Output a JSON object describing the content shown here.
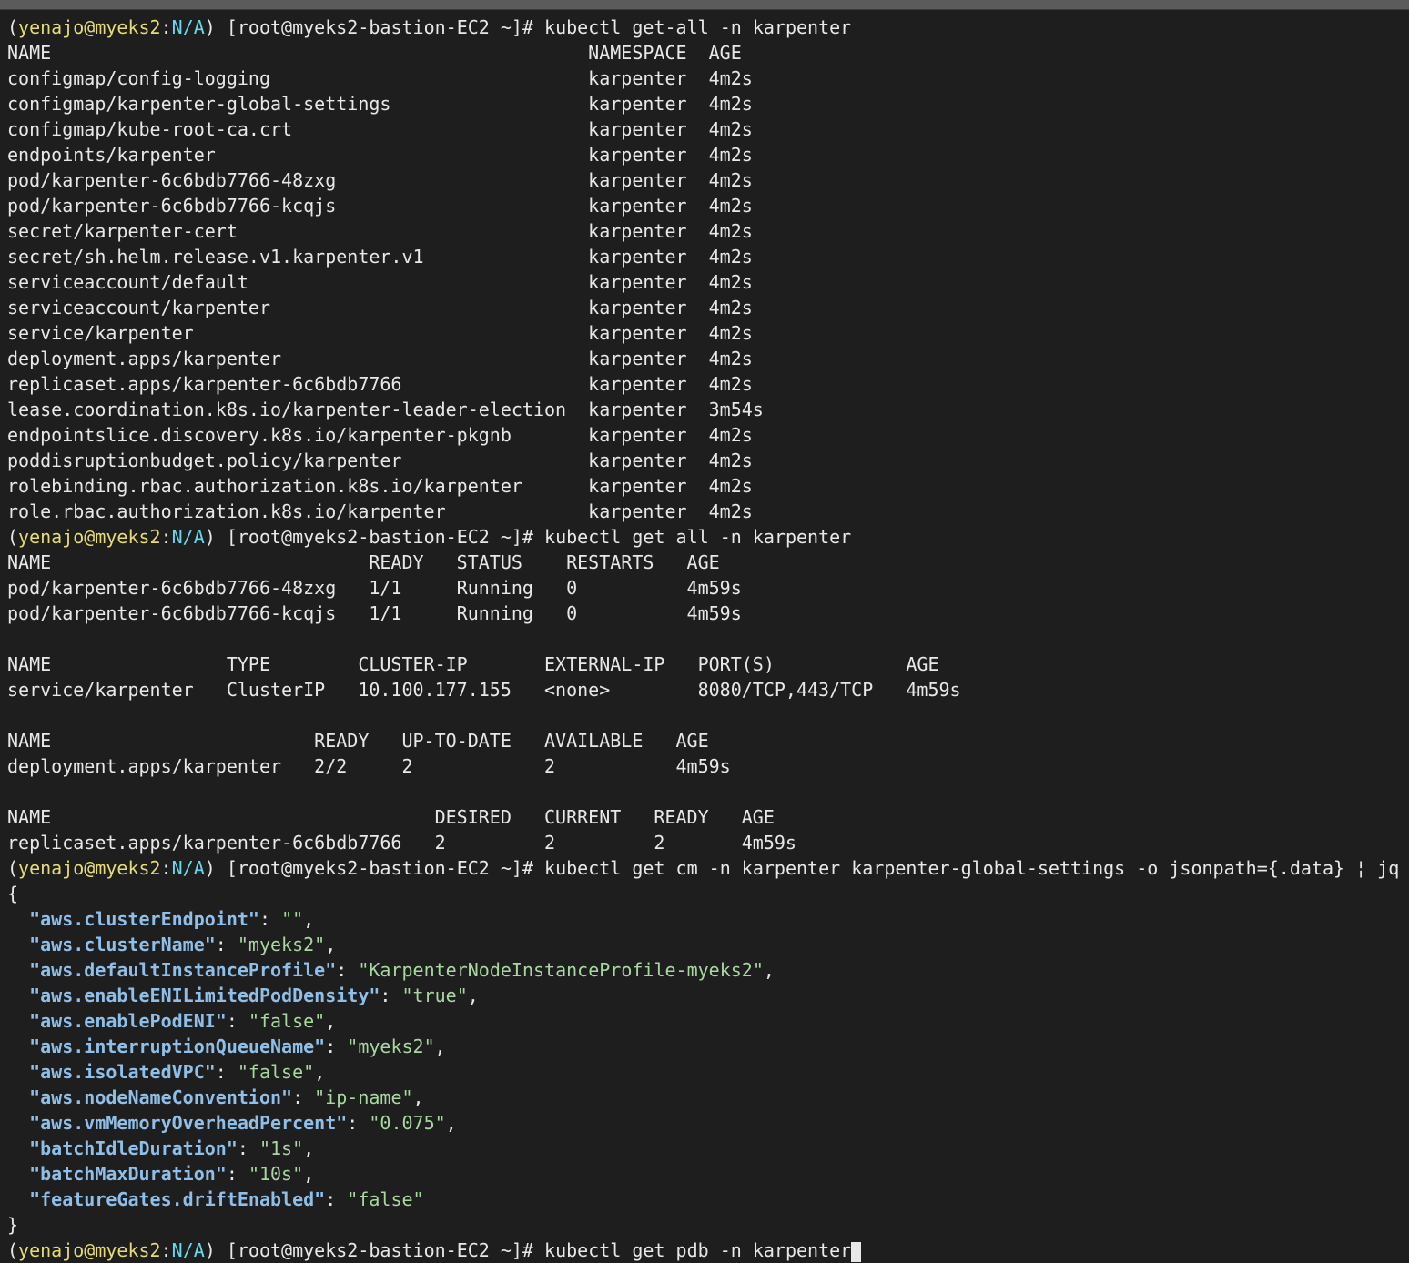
{
  "prompt": {
    "open": "(",
    "user": "yenajo@myeks2",
    "sep": ":",
    "ctx": "N/A",
    "host": ") [root@myeks2-bastion-EC2 ~]# "
  },
  "commands": [
    "kubectl get-all -n karpenter",
    "kubectl get all -n karpenter",
    "kubectl get cm -n karpenter karpenter-global-settings -o jsonpath={.data} ¦ jq",
    "kubectl get pdb -n karpenter"
  ],
  "output_getall": [
    "NAME                                                 NAMESPACE  AGE",
    "configmap/config-logging                             karpenter  4m2s",
    "configmap/karpenter-global-settings                  karpenter  4m2s",
    "configmap/kube-root-ca.crt                           karpenter  4m2s",
    "endpoints/karpenter                                  karpenter  4m2s",
    "pod/karpenter-6c6bdb7766-48zxg                       karpenter  4m2s",
    "pod/karpenter-6c6bdb7766-kcqjs                       karpenter  4m2s",
    "secret/karpenter-cert                                karpenter  4m2s",
    "secret/sh.helm.release.v1.karpenter.v1               karpenter  4m2s",
    "serviceaccount/default                               karpenter  4m2s",
    "serviceaccount/karpenter                             karpenter  4m2s",
    "service/karpenter                                    karpenter  4m2s",
    "deployment.apps/karpenter                            karpenter  4m2s",
    "replicaset.apps/karpenter-6c6bdb7766                 karpenter  4m2s",
    "lease.coordination.k8s.io/karpenter-leader-election  karpenter  3m54s",
    "endpointslice.discovery.k8s.io/karpenter-pkgnb       karpenter  4m2s",
    "poddisruptionbudget.policy/karpenter                 karpenter  4m2s",
    "rolebinding.rbac.authorization.k8s.io/karpenter      karpenter  4m2s",
    "role.rbac.authorization.k8s.io/karpenter             karpenter  4m2s"
  ],
  "output_getall2": [
    "NAME                             READY   STATUS    RESTARTS   AGE",
    "pod/karpenter-6c6bdb7766-48zxg   1/1     Running   0          4m59s",
    "pod/karpenter-6c6bdb7766-kcqjs   1/1     Running   0          4m59s",
    "",
    "NAME                TYPE        CLUSTER-IP       EXTERNAL-IP   PORT(S)            AGE",
    "service/karpenter   ClusterIP   10.100.177.155   <none>        8080/TCP,443/TCP   4m59s",
    "",
    "NAME                        READY   UP-TO-DATE   AVAILABLE   AGE",
    "deployment.apps/karpenter   2/2     2            2           4m59s",
    "",
    "NAME                                   DESIRED   CURRENT   READY   AGE",
    "replicaset.apps/karpenter-6c6bdb7766   2         2         2       4m59s"
  ],
  "json": {
    "open_brace": "{",
    "close_brace": "}",
    "entries": [
      {
        "key": "\"aws.clusterEndpoint\"",
        "value": "\"\"",
        "trail": ","
      },
      {
        "key": "\"aws.clusterName\"",
        "value": "\"myeks2\"",
        "trail": ","
      },
      {
        "key": "\"aws.defaultInstanceProfile\"",
        "value": "\"KarpenterNodeInstanceProfile-myeks2\"",
        "trail": ","
      },
      {
        "key": "\"aws.enableENILimitedPodDensity\"",
        "value": "\"true\"",
        "trail": ","
      },
      {
        "key": "\"aws.enablePodENI\"",
        "value": "\"false\"",
        "trail": ","
      },
      {
        "key": "\"aws.interruptionQueueName\"",
        "value": "\"myeks2\"",
        "trail": ","
      },
      {
        "key": "\"aws.isolatedVPC\"",
        "value": "\"false\"",
        "trail": ","
      },
      {
        "key": "\"aws.nodeNameConvention\"",
        "value": "\"ip-name\"",
        "trail": ","
      },
      {
        "key": "\"aws.vmMemoryOverheadPercent\"",
        "value": "\"0.075\"",
        "trail": ","
      },
      {
        "key": "\"batchIdleDuration\"",
        "value": "\"1s\"",
        "trail": ","
      },
      {
        "key": "\"batchMaxDuration\"",
        "value": "\"10s\"",
        "trail": ","
      },
      {
        "key": "\"featureGates.driftEnabled\"",
        "value": "\"false\"",
        "trail": ""
      }
    ]
  }
}
